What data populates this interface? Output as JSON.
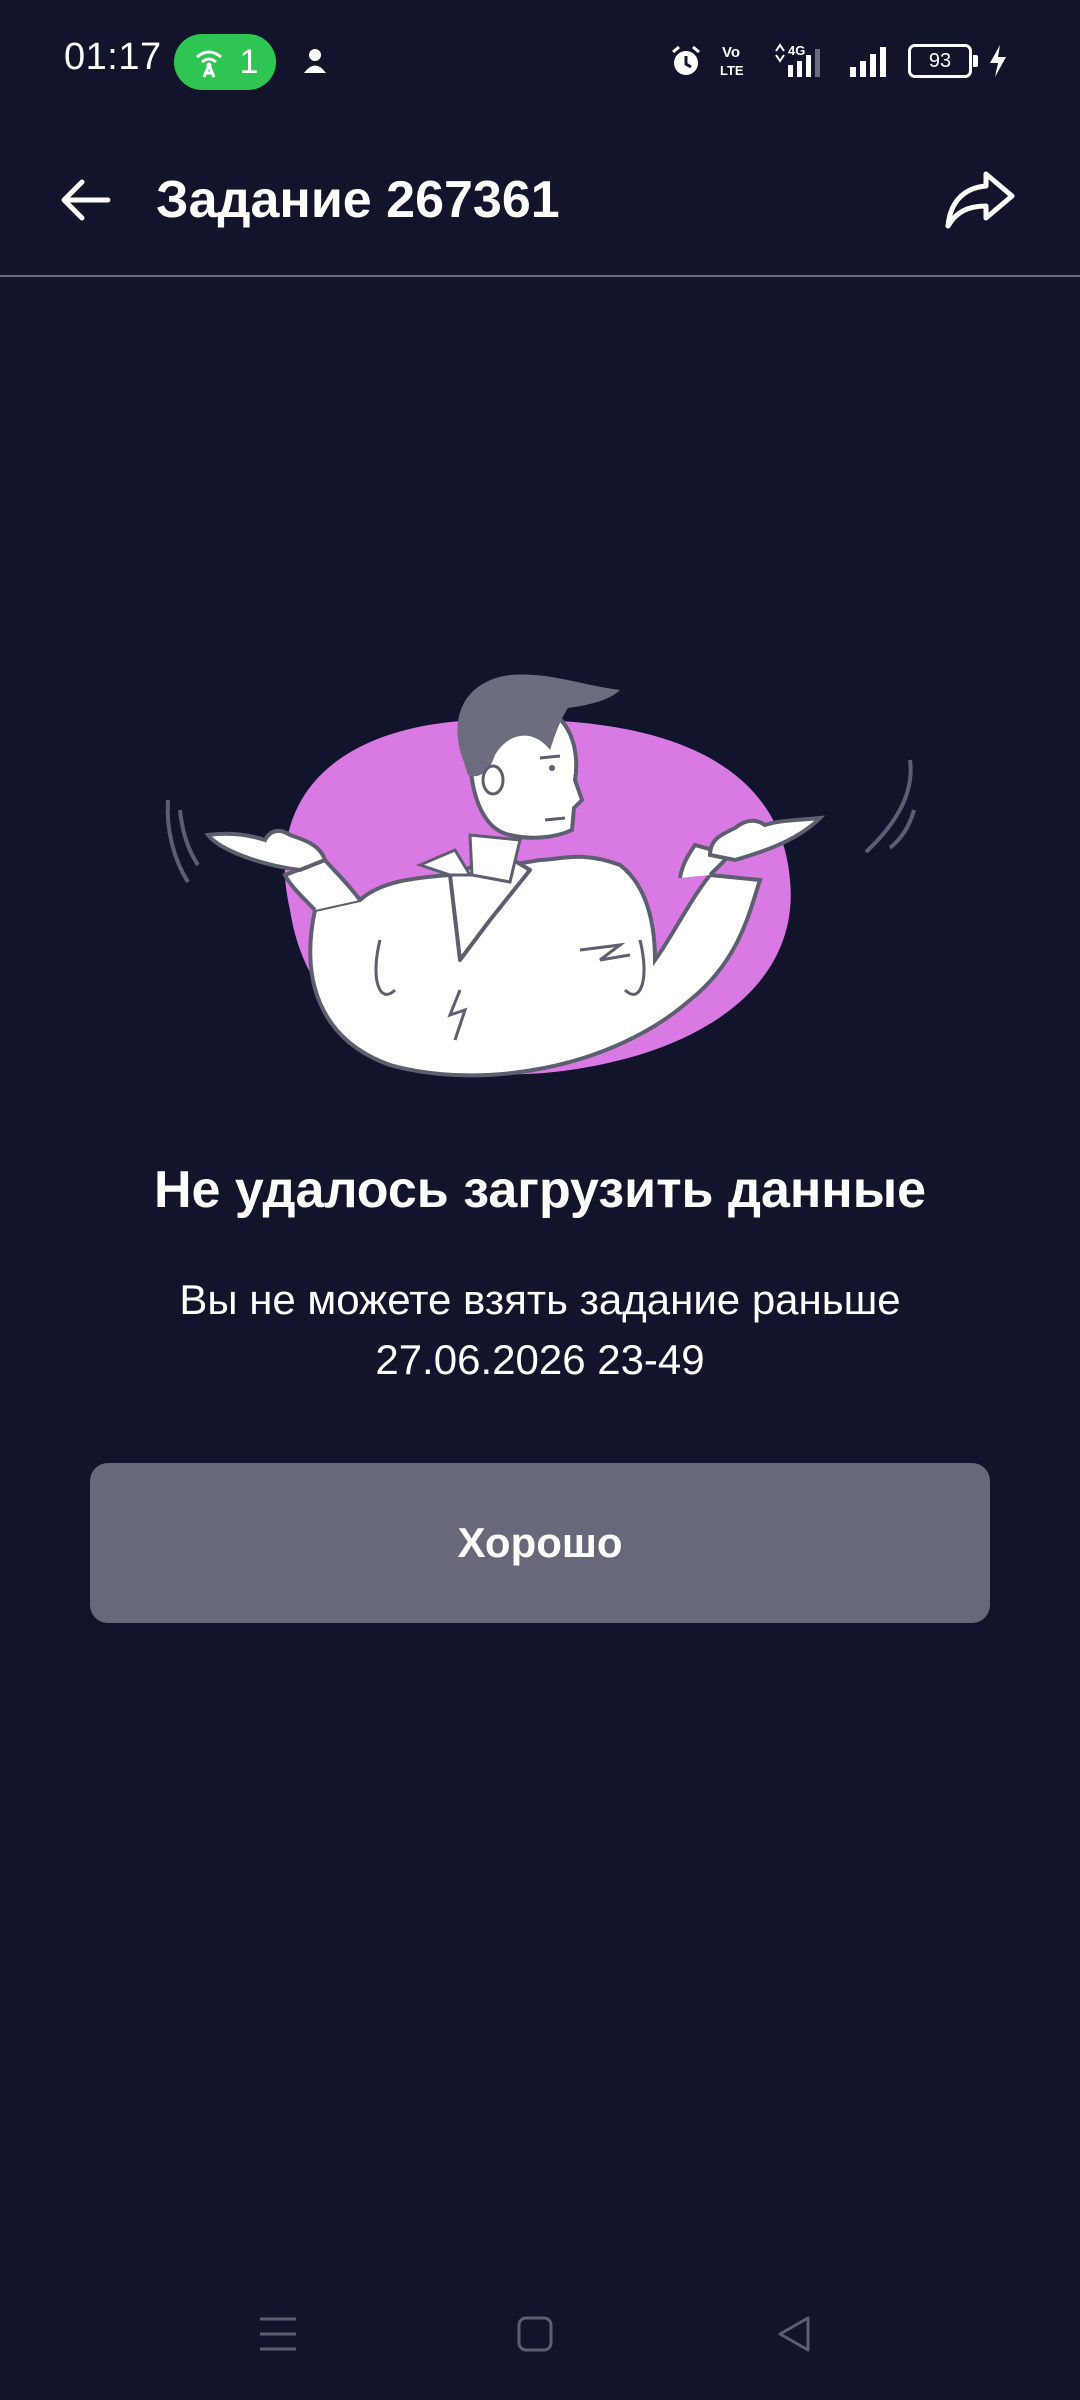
{
  "status_bar": {
    "time": "01:17",
    "hotspot_count": "1",
    "battery_level": "93",
    "network_labels": {
      "volte": "Vo LTE",
      "network": "4G"
    },
    "icons": [
      "hotspot-icon",
      "user-icon",
      "alarm-icon",
      "volte-icon",
      "signal-icon",
      "signal-icon",
      "battery-icon",
      "charging-icon"
    ]
  },
  "toolbar": {
    "title": "Задание 267361",
    "back_icon": "arrow-left-icon",
    "share_icon": "share-icon"
  },
  "error": {
    "heading": "Не удалось загрузить данные",
    "message": "Вы не можете взять задание раньше 27.06.2026 23-49",
    "button_label": "Хорошо"
  },
  "navigation_bar": [
    "menu-icon",
    "home-icon",
    "back-icon"
  ],
  "colors": {
    "background": "#11142b",
    "button": "#676879",
    "accent_pink": "#d97ae4",
    "hotspot_green": "#2fc553",
    "illustration_line": "#5d5e70"
  }
}
